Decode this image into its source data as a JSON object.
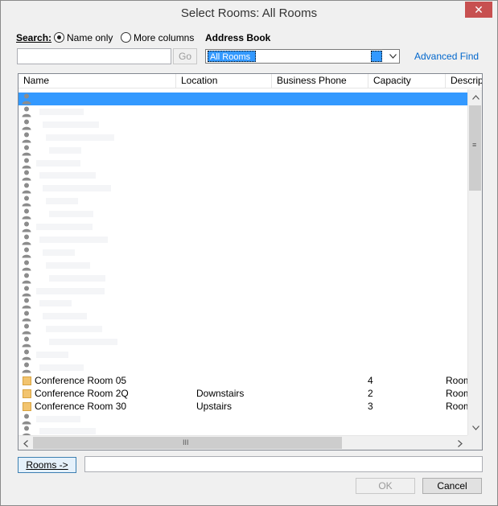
{
  "window": {
    "title": "Select Rooms: All Rooms",
    "close_label": "✕"
  },
  "search": {
    "label": "Search:",
    "option_name_only": "Name only",
    "option_more_columns": "More columns",
    "selected_option": "Name only",
    "input_value": "",
    "go_label": "Go"
  },
  "address_book": {
    "label": "Address Book",
    "selected": "All Rooms -"
  },
  "advanced_find": "Advanced Find",
  "table": {
    "columns": [
      "Name",
      "Location",
      "Business Phone",
      "Capacity",
      "Descrip"
    ],
    "rows": [
      {
        "name": "Conference Room 05",
        "location": "",
        "phone": "",
        "capacity": "4",
        "description": "Room"
      },
      {
        "name": "Conference Room 2Q",
        "location": "Downstairs",
        "phone": "",
        "capacity": "2",
        "description": "Room"
      },
      {
        "name": "Conference Room 30",
        "location": "Upstairs",
        "phone": "",
        "capacity": "3",
        "description": "Room"
      }
    ],
    "scroll_grip": "III",
    "scroll_grip_v": "≡"
  },
  "footer": {
    "rooms_button": "Rooms ->",
    "rooms_value": "",
    "ok_label": "OK",
    "cancel_label": "Cancel"
  },
  "colors": {
    "selection": "#3399ff",
    "link": "#0066cc",
    "room_icon": "#f2c46f"
  }
}
